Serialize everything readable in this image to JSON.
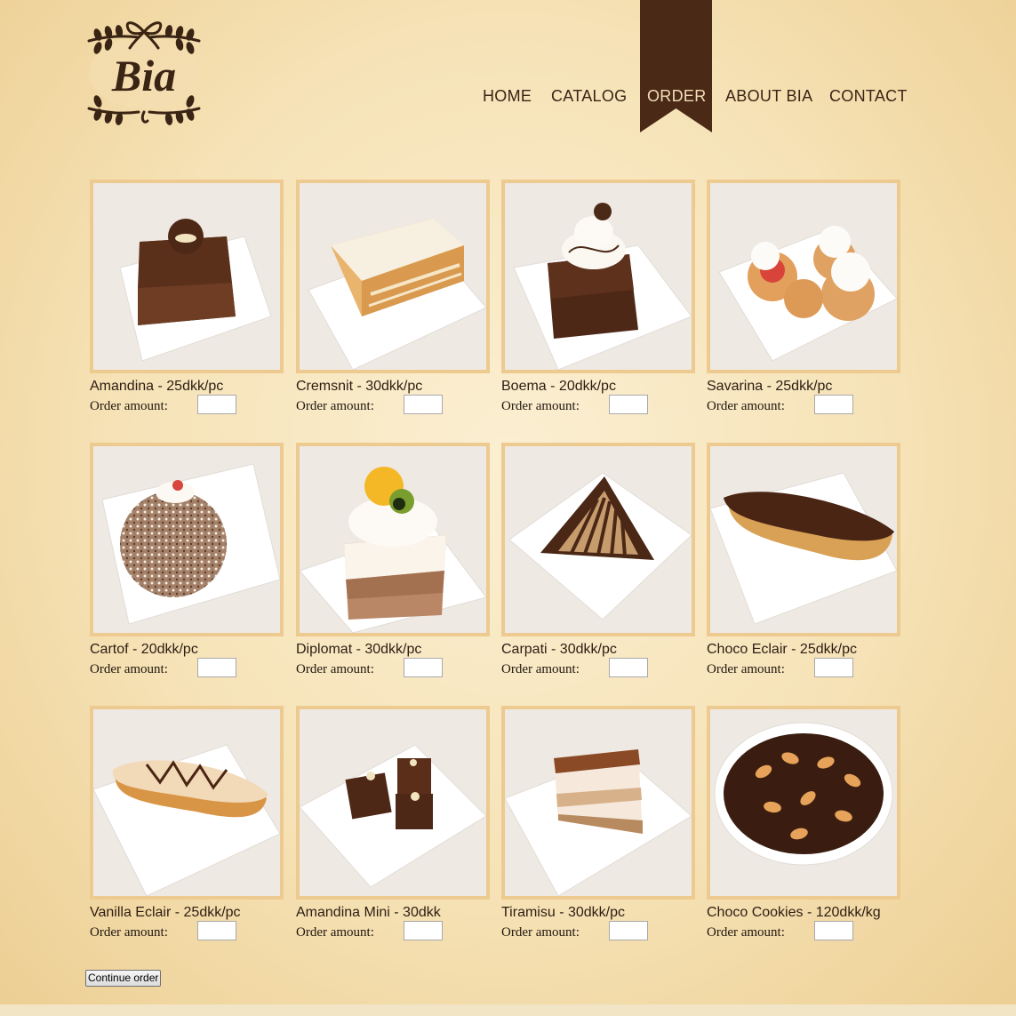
{
  "brand": {
    "logo_text": "Bia"
  },
  "nav": {
    "items": [
      {
        "label": "HOME",
        "active": false
      },
      {
        "label": "CATALOG",
        "active": false
      },
      {
        "label": "ORDER",
        "active": true
      },
      {
        "label": "ABOUT BIA",
        "active": false
      },
      {
        "label": "CONTACT",
        "active": false
      }
    ]
  },
  "products": [
    {
      "title": "Amandina - 25dkk/pc",
      "order_label": "Order amount:",
      "amount": "",
      "image": "chocolate-cake-square"
    },
    {
      "title": "Cremsnit - 30dkk/pc",
      "order_label": "Order amount:",
      "amount": "",
      "image": "cream-puff-pastry"
    },
    {
      "title": "Boema - 20dkk/pc",
      "order_label": "Order amount:",
      "amount": "",
      "image": "chocolate-cake-cream-top"
    },
    {
      "title": "Savarina - 25dkk/pc",
      "order_label": "Order amount:",
      "amount": "",
      "image": "cream-puffs"
    },
    {
      "title": "Cartof - 20dkk/pc",
      "order_label": "Order amount:",
      "amount": "",
      "image": "coconut-ball"
    },
    {
      "title": "Diplomat - 30dkk/pc",
      "order_label": "Order amount:",
      "amount": "",
      "image": "layered-cake-fruit"
    },
    {
      "title": "Carpati - 30dkk/pc",
      "order_label": "Order amount:",
      "amount": "",
      "image": "chocolate-triangle"
    },
    {
      "title": "Choco Eclair - 25dkk/pc",
      "order_label": "Order amount:",
      "amount": "",
      "image": "chocolate-eclair"
    },
    {
      "title": "Vanilla Eclair - 25dkk/pc",
      "order_label": "Order amount:",
      "amount": "",
      "image": "vanilla-eclair"
    },
    {
      "title": "Amandina Mini - 30dkk",
      "order_label": "Order amount:",
      "amount": "",
      "image": "mini-chocolate-cakes"
    },
    {
      "title": "Tiramisu - 30dkk/pc",
      "order_label": "Order amount:",
      "amount": "",
      "image": "tiramisu-slice"
    },
    {
      "title": "Choco Cookies - 120dkk/kg",
      "order_label": "Order amount:",
      "amount": "",
      "image": "cookie-platter"
    }
  ],
  "actions": {
    "continue_label": "Continue order"
  },
  "colors": {
    "accent": "#4a2a17",
    "frame": "#edca8f",
    "text": "#2d1d12",
    "background": "#f6e2b6"
  }
}
